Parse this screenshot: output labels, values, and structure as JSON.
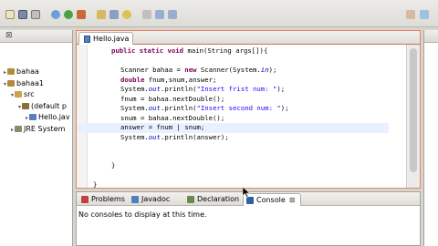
{
  "editor": {
    "tab_title": "Hello.java",
    "close_glyph": "⊠",
    "lines": [
      {
        "indent": 2,
        "parts": [
          {
            "t": "public static void ",
            "c": "kw"
          },
          {
            "t": "main(String args[]){",
            "c": ""
          }
        ]
      },
      {
        "indent": 0,
        "parts": []
      },
      {
        "indent": 3,
        "parts": [
          {
            "t": "Scanner bahaa = ",
            "c": ""
          },
          {
            "t": "new",
            "c": "kw"
          },
          {
            "t": " Scanner(System.",
            "c": ""
          },
          {
            "t": "in",
            "c": "fd"
          },
          {
            "t": ");",
            "c": ""
          }
        ]
      },
      {
        "indent": 3,
        "parts": [
          {
            "t": "double",
            "c": "kw"
          },
          {
            "t": " fnum,snum,answer;",
            "c": ""
          }
        ]
      },
      {
        "indent": 3,
        "parts": [
          {
            "t": "System.",
            "c": ""
          },
          {
            "t": "out",
            "c": "fd"
          },
          {
            "t": ".println(",
            "c": ""
          },
          {
            "t": "\"Insert frist num: \"",
            "c": "st"
          },
          {
            "t": ");",
            "c": ""
          }
        ]
      },
      {
        "indent": 3,
        "parts": [
          {
            "t": "fnum = bahaa.nextDouble();",
            "c": ""
          }
        ]
      },
      {
        "indent": 3,
        "parts": [
          {
            "t": "System.",
            "c": ""
          },
          {
            "t": "out",
            "c": "fd"
          },
          {
            "t": ".println(",
            "c": ""
          },
          {
            "t": "\"Insert second num: \"",
            "c": "st"
          },
          {
            "t": ");",
            "c": ""
          }
        ]
      },
      {
        "indent": 3,
        "parts": [
          {
            "t": "snum = bahaa.nextDouble();",
            "c": ""
          }
        ]
      },
      {
        "indent": 3,
        "parts": [
          {
            "t": "answer = fnum ",
            "c": ""
          },
          {
            "t": "|",
            "c": ""
          },
          {
            "t": " snum;",
            "c": ""
          }
        ],
        "highlight": true
      },
      {
        "indent": 3,
        "parts": [
          {
            "t": "System.",
            "c": ""
          },
          {
            "t": "out",
            "c": "fd"
          },
          {
            "t": ".println(answer);",
            "c": ""
          }
        ]
      },
      {
        "indent": 0,
        "parts": []
      },
      {
        "indent": 0,
        "parts": []
      },
      {
        "indent": 2,
        "parts": [
          {
            "t": "}",
            "c": ""
          }
        ]
      },
      {
        "indent": 0,
        "parts": []
      },
      {
        "indent": 0,
        "parts": [
          {
            "t": "}",
            "c": ""
          }
        ]
      }
    ]
  },
  "package_explorer": {
    "close_glyph": "⊠",
    "items": [
      {
        "label": "bahaa",
        "expander": "▸",
        "level": 0,
        "icon": "project-icon"
      },
      {
        "label": "bahaa1",
        "expander": "▾",
        "level": 0,
        "icon": "project-icon"
      },
      {
        "label": "src",
        "expander": "▾",
        "level": 1,
        "icon": "source-folder-icon"
      },
      {
        "label": "(default p",
        "expander": "▾",
        "level": 2,
        "icon": "package-icon"
      },
      {
        "label": "Hello.jav",
        "expander": "▸",
        "level": 3,
        "icon": "java-file-icon"
      },
      {
        "label": "JRE System",
        "expander": "▸",
        "level": 1,
        "icon": "library-icon"
      }
    ]
  },
  "bottom_panel": {
    "tabs": [
      {
        "label": "Problems",
        "name": "tab-problems",
        "color": "#c04040"
      },
      {
        "label": "Javadoc",
        "name": "tab-javadoc",
        "color": "#5080c0"
      },
      {
        "label": "Declaration",
        "name": "tab-declaration",
        "color": "#6a8a50"
      },
      {
        "label": "Console",
        "name": "tab-console",
        "color": "#3060a0",
        "active": true,
        "close": "⊠"
      }
    ],
    "message": "No consoles to display at this time."
  },
  "colors": {
    "keyword": "#7f0055",
    "string": "#2a00ff",
    "field": "#0000c0",
    "active_border": "#f08060"
  }
}
